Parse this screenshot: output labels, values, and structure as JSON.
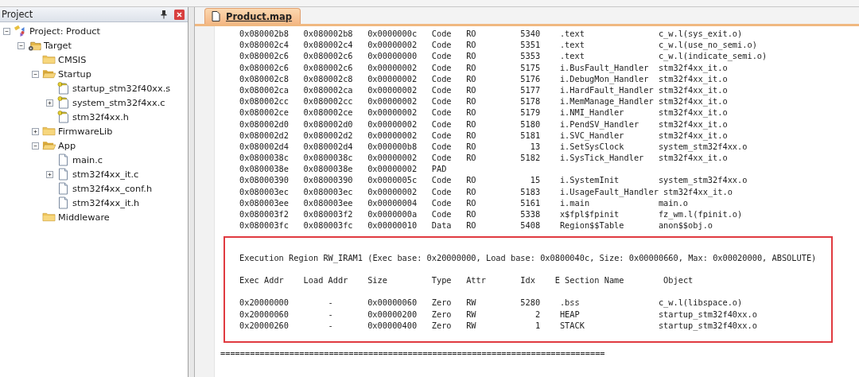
{
  "project_panel": {
    "title": "Project"
  },
  "tree": [
    {
      "label": "Project: Product",
      "kind": "project",
      "expanded": true,
      "children": [
        {
          "label": "Target",
          "kind": "target",
          "expanded": true,
          "children": [
            {
              "label": "CMSIS",
              "kind": "folder"
            },
            {
              "label": "Startup",
              "kind": "folder",
              "expanded": true,
              "children": [
                {
                  "label": "startup_stm32f40xx.s",
                  "kind": "keyfile"
                },
                {
                  "label": "system_stm32f4xx.c",
                  "kind": "keyfile",
                  "expanded": false
                },
                {
                  "label": "stm32f4xx.h",
                  "kind": "keyfile"
                }
              ]
            },
            {
              "label": "FirmwareLib",
              "kind": "folder",
              "expanded": false
            },
            {
              "label": "App",
              "kind": "folder",
              "expanded": true,
              "children": [
                {
                  "label": "main.c",
                  "kind": "file"
                },
                {
                  "label": "stm32f4xx_it.c",
                  "kind": "file",
                  "expanded": false
                },
                {
                  "label": "stm32f4xx_conf.h",
                  "kind": "file"
                },
                {
                  "label": "stm32f4xx_it.h",
                  "kind": "file"
                }
              ]
            },
            {
              "label": "Middleware",
              "kind": "folder"
            }
          ]
        }
      ]
    }
  ],
  "editor": {
    "tabs": [
      {
        "label": "Product.map",
        "selected": true
      }
    ],
    "rows": [
      {
        "exec_addr": "0x080002b8",
        "load_addr": "0x080002b8",
        "size": "0x0000000c",
        "type": "Code",
        "attr": "RO",
        "idx": "5340",
        "section": ".text",
        "object": "c_w.l(sys_exit.o)"
      },
      {
        "exec_addr": "0x080002c4",
        "load_addr": "0x080002c4",
        "size": "0x00000002",
        "type": "Code",
        "attr": "RO",
        "idx": "5351",
        "section": ".text",
        "object": "c_w.l(use_no_semi.o)"
      },
      {
        "exec_addr": "0x080002c6",
        "load_addr": "0x080002c6",
        "size": "0x00000000",
        "type": "Code",
        "attr": "RO",
        "idx": "5353",
        "section": ".text",
        "object": "c_w.l(indicate_semi.o)"
      },
      {
        "exec_addr": "0x080002c6",
        "load_addr": "0x080002c6",
        "size": "0x00000002",
        "type": "Code",
        "attr": "RO",
        "idx": "5175",
        "section": "i.BusFault_Handler",
        "object": "stm32f4xx_it.o"
      },
      {
        "exec_addr": "0x080002c8",
        "load_addr": "0x080002c8",
        "size": "0x00000002",
        "type": "Code",
        "attr": "RO",
        "idx": "5176",
        "section": "i.DebugMon_Handler",
        "object": "stm32f4xx_it.o"
      },
      {
        "exec_addr": "0x080002ca",
        "load_addr": "0x080002ca",
        "size": "0x00000002",
        "type": "Code",
        "attr": "RO",
        "idx": "5177",
        "section": "i.HardFault_Handler",
        "object": "stm32f4xx_it.o"
      },
      {
        "exec_addr": "0x080002cc",
        "load_addr": "0x080002cc",
        "size": "0x00000002",
        "type": "Code",
        "attr": "RO",
        "idx": "5178",
        "section": "i.MemManage_Handler",
        "object": "stm32f4xx_it.o"
      },
      {
        "exec_addr": "0x080002ce",
        "load_addr": "0x080002ce",
        "size": "0x00000002",
        "type": "Code",
        "attr": "RO",
        "idx": "5179",
        "section": "i.NMI_Handler",
        "object": "stm32f4xx_it.o"
      },
      {
        "exec_addr": "0x080002d0",
        "load_addr": "0x080002d0",
        "size": "0x00000002",
        "type": "Code",
        "attr": "RO",
        "idx": "5180",
        "section": "i.PendSV_Handler",
        "object": "stm32f4xx_it.o"
      },
      {
        "exec_addr": "0x080002d2",
        "load_addr": "0x080002d2",
        "size": "0x00000002",
        "type": "Code",
        "attr": "RO",
        "idx": "5181",
        "section": "i.SVC_Handler",
        "object": "stm32f4xx_it.o"
      },
      {
        "exec_addr": "0x080002d4",
        "load_addr": "0x080002d4",
        "size": "0x000000b8",
        "type": "Code",
        "attr": "RO",
        "idx": "13",
        "section": "i.SetSysClock",
        "object": "system_stm32f4xx.o"
      },
      {
        "exec_addr": "0x0800038c",
        "load_addr": "0x0800038c",
        "size": "0x00000002",
        "type": "Code",
        "attr": "RO",
        "idx": "5182",
        "section": "i.SysTick_Handler",
        "object": "stm32f4xx_it.o"
      },
      {
        "exec_addr": "0x0800038e",
        "load_addr": "0x0800038e",
        "size": "0x00000002",
        "type": "PAD"
      },
      {
        "exec_addr": "0x08000390",
        "load_addr": "0x08000390",
        "size": "0x0000005c",
        "type": "Code",
        "attr": "RO",
        "idx": "15",
        "section": "i.SystemInit",
        "object": "system_stm32f4xx.o"
      },
      {
        "exec_addr": "0x080003ec",
        "load_addr": "0x080003ec",
        "size": "0x00000002",
        "type": "Code",
        "attr": "RO",
        "idx": "5183",
        "section": "i.UsageFault_Handler",
        "object": "stm32f4xx_it.o"
      },
      {
        "exec_addr": "0x080003ee",
        "load_addr": "0x080003ee",
        "size": "0x00000004",
        "type": "Code",
        "attr": "RO",
        "idx": "5161",
        "section": "i.main",
        "object": "main.o"
      },
      {
        "exec_addr": "0x080003f2",
        "load_addr": "0x080003f2",
        "size": "0x0000000a",
        "type": "Code",
        "attr": "RO",
        "idx": "5338",
        "section": "x$fpl$fpinit",
        "object": "fz_wm.l(fpinit.o)"
      },
      {
        "exec_addr": "0x080003fc",
        "load_addr": "0x080003fc",
        "size": "0x00000010",
        "type": "Data",
        "attr": "RO",
        "idx": "5408",
        "section": "Region$$Table",
        "object": "anon$$obj.o"
      }
    ],
    "region": {
      "title": "Execution Region RW_IRAM1 (Exec base: 0x20000000, Load base: 0x0800040c, Size: 0x00000660, Max: 0x00020000, ABSOLUTE)",
      "columns": [
        "Exec Addr",
        "Load Addr",
        "Size",
        "Type",
        "Attr",
        "Idx",
        "E",
        "Section Name",
        "Object"
      ],
      "rows": [
        {
          "exec_addr": "0x20000000",
          "load_addr": "-",
          "size": "0x00000060",
          "type": "Zero",
          "attr": "RW",
          "idx": "5280",
          "section": ".bss",
          "object": "c_w.l(libspace.o)"
        },
        {
          "exec_addr": "0x20000060",
          "load_addr": "-",
          "size": "0x00000200",
          "type": "Zero",
          "attr": "RW",
          "idx": "2",
          "section": "HEAP",
          "object": "startup_stm32f40xx.o"
        },
        {
          "exec_addr": "0x20000260",
          "load_addr": "-",
          "size": "0x00000400",
          "type": "Zero",
          "attr": "RW",
          "idx": "1",
          "section": "STACK",
          "object": "startup_stm32f40xx.o"
        }
      ]
    },
    "separator": "=============================================================================="
  }
}
